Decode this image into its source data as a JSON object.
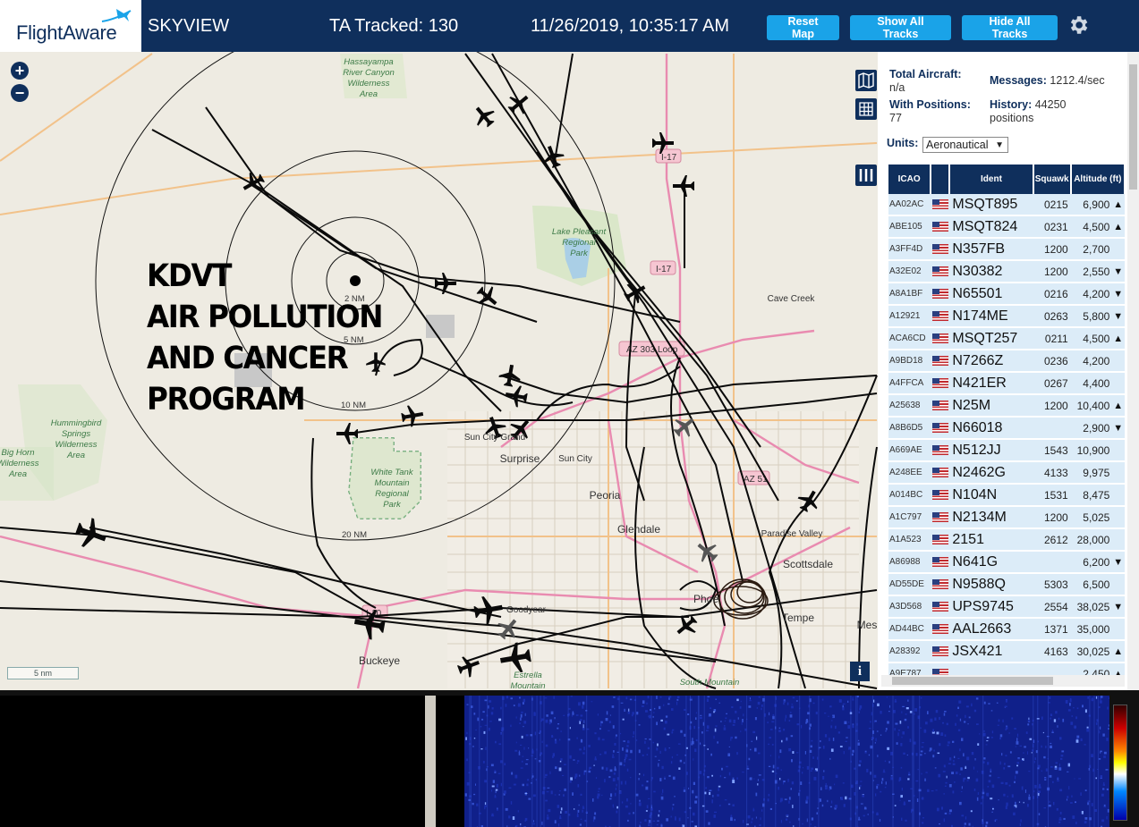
{
  "header": {
    "logo_flight": "Flight",
    "logo_aware": "Aware",
    "site_name": "SKYVIEW",
    "tracked": "TA Tracked: 130",
    "clock": "11/26/2019, 10:35:17 AM",
    "buttons": {
      "reset": "Reset Map",
      "show": "Show All Tracks",
      "hide": "Hide All Tracks"
    },
    "settings_icon": "gear-icon"
  },
  "map": {
    "overlay_lines": [
      "KDVT",
      "AIR POLLUTION",
      "AND CANCER",
      "PROGRAM"
    ],
    "range_labels": [
      "2 NM",
      "5 NM",
      "10 NM",
      "20 NM"
    ],
    "scale_label": "5 nm",
    "places": {
      "hassayampa": [
        "Hassayampa",
        "River Canyon",
        "Wilderness",
        "Area"
      ],
      "lake_pleasant": [
        "Lake Pleasant",
        "Regional",
        "Park"
      ],
      "cave_creek": "Cave Creek",
      "hummingbird": [
        "Hummingbird",
        "Springs",
        "Wilderness",
        "Area"
      ],
      "big_horn": [
        "Big Horn",
        "Wilderness",
        "Area"
      ],
      "white_tank": [
        "White Tank",
        "Mountain",
        "Regional",
        "Park"
      ],
      "surprise": "Surprise",
      "sun_city": "Sun City",
      "sun_city_grand": "Sun City Grand",
      "peoria": "Peoria",
      "glendale": "Glendale",
      "paradise_valley": "Paradise Valley",
      "scottsdale": "Scottsdale",
      "tempe": "Tempe",
      "phoenix": "Phoe",
      "mesa": "Mes",
      "goodyear": "Goodyear",
      "buckeye": "Buckeye",
      "estrella": [
        "Estrella",
        "Mountain"
      ],
      "south_mountain": "South Mountain"
    },
    "shields": {
      "i17": "I-17",
      "i17b": "I-17",
      "az303": "AZ 303 Loop",
      "az51": "AZ 51",
      "i10": "I-10"
    }
  },
  "panel": {
    "total_aircraft_label": "Total Aircraft:",
    "total_aircraft_value": "n/a",
    "messages_label": "Messages:",
    "messages_value": "1212.4/sec",
    "with_positions_label": "With Positions:",
    "with_positions_value": "77",
    "history_label": "History:",
    "history_value": "44250 positions",
    "units_label": "Units:",
    "units_value": "Aeronautical",
    "columns": [
      "ICAO",
      "",
      "Ident",
      "Squawk",
      "Altitude (ft)"
    ],
    "rows": [
      {
        "icao": "AA02AC",
        "ident": "MSQT895",
        "squawk": "0215",
        "alt": "6,900",
        "trend": "▲"
      },
      {
        "icao": "ABE105",
        "ident": "MSQT824",
        "squawk": "0231",
        "alt": "4,500",
        "trend": "▲"
      },
      {
        "icao": "A3FF4D",
        "ident": "N357FB",
        "squawk": "1200",
        "alt": "2,700",
        "trend": ""
      },
      {
        "icao": "A32E02",
        "ident": "N30382",
        "squawk": "1200",
        "alt": "2,550",
        "trend": "▼"
      },
      {
        "icao": "A8A1BF",
        "ident": "N65501",
        "squawk": "0216",
        "alt": "4,200",
        "trend": "▼"
      },
      {
        "icao": "A12921",
        "ident": "N174ME",
        "squawk": "0263",
        "alt": "5,800",
        "trend": "▼"
      },
      {
        "icao": "ACA6CD",
        "ident": "MSQT257",
        "squawk": "0211",
        "alt": "4,500",
        "trend": "▲"
      },
      {
        "icao": "A9BD18",
        "ident": "N7266Z",
        "squawk": "0236",
        "alt": "4,200",
        "trend": ""
      },
      {
        "icao": "A4FFCA",
        "ident": "N421ER",
        "squawk": "0267",
        "alt": "4,400",
        "trend": ""
      },
      {
        "icao": "A25638",
        "ident": "N25M",
        "squawk": "1200",
        "alt": "10,400",
        "trend": "▲"
      },
      {
        "icao": "A8B6D5",
        "ident": "N66018",
        "squawk": "",
        "alt": "2,900",
        "trend": "▼"
      },
      {
        "icao": "A669AE",
        "ident": "N512JJ",
        "squawk": "1543",
        "alt": "10,900",
        "trend": ""
      },
      {
        "icao": "A248EE",
        "ident": "N2462G",
        "squawk": "4133",
        "alt": "9,975",
        "trend": ""
      },
      {
        "icao": "A014BC",
        "ident": "N104N",
        "squawk": "1531",
        "alt": "8,475",
        "trend": ""
      },
      {
        "icao": "A1C797",
        "ident": "N2134M",
        "squawk": "1200",
        "alt": "5,025",
        "trend": ""
      },
      {
        "icao": "A1A523",
        "ident": "2151",
        "squawk": "2612",
        "alt": "28,000",
        "trend": ""
      },
      {
        "icao": "A86988",
        "ident": "N641G",
        "squawk": "",
        "alt": "6,200",
        "trend": "▼"
      },
      {
        "icao": "AD55DE",
        "ident": "N9588Q",
        "squawk": "5303",
        "alt": "6,500",
        "trend": ""
      },
      {
        "icao": "A3D568",
        "ident": "UPS9745",
        "squawk": "2554",
        "alt": "38,025",
        "trend": "▼"
      },
      {
        "icao": "AD44BC",
        "ident": "AAL2663",
        "squawk": "1371",
        "alt": "35,000",
        "trend": ""
      },
      {
        "icao": "A28392",
        "ident": "JSX421",
        "squawk": "4163",
        "alt": "30,025",
        "trend": "▲"
      },
      {
        "icao": "A9E787",
        "ident": "",
        "squawk": "",
        "alt": "2,450",
        "trend": "▲"
      }
    ]
  }
}
